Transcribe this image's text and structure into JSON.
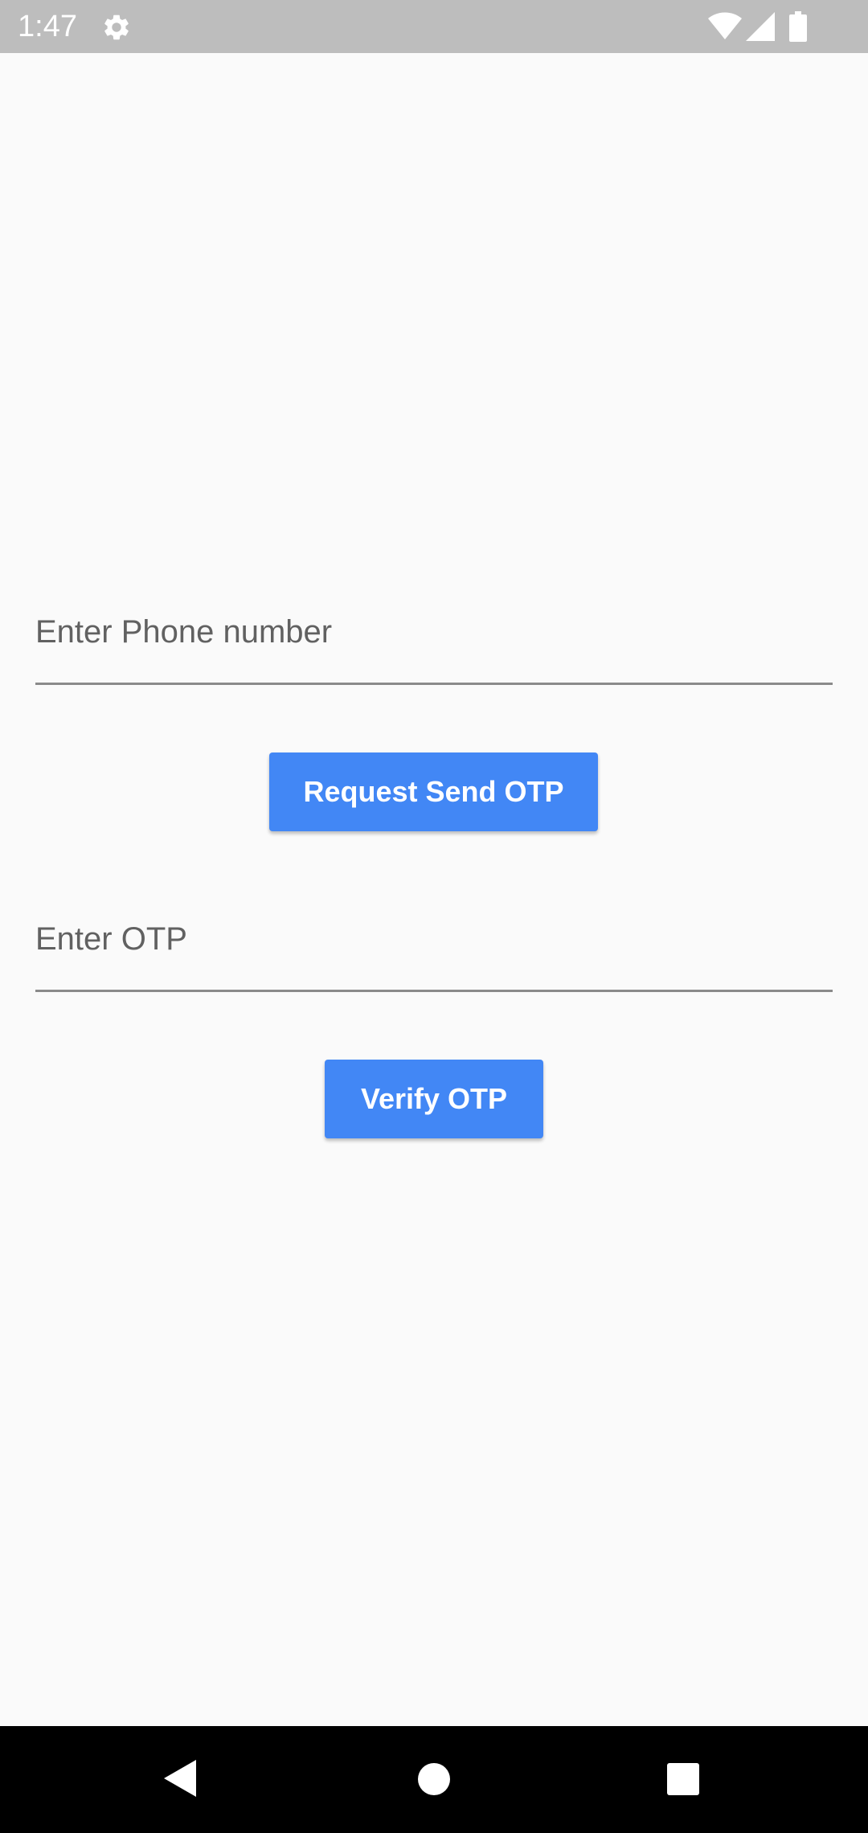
{
  "status_bar": {
    "time": "1:47",
    "icons": [
      "gear-icon",
      "wifi-icon",
      "signal-icon",
      "battery-icon"
    ]
  },
  "form": {
    "phone": {
      "placeholder": "Enter Phone number",
      "value": ""
    },
    "request_button_label": "Request Send OTP",
    "otp": {
      "placeholder": "Enter OTP",
      "value": ""
    },
    "verify_button_label": "Verify OTP"
  },
  "nav_bar": {
    "icons": [
      "back-icon",
      "home-icon",
      "recents-icon"
    ]
  },
  "colors": {
    "background": "#fafafa",
    "status_bar": "#bdbdbd",
    "button": "#4287f5",
    "button_text": "#ffffff",
    "nav_bar": "#000000"
  }
}
